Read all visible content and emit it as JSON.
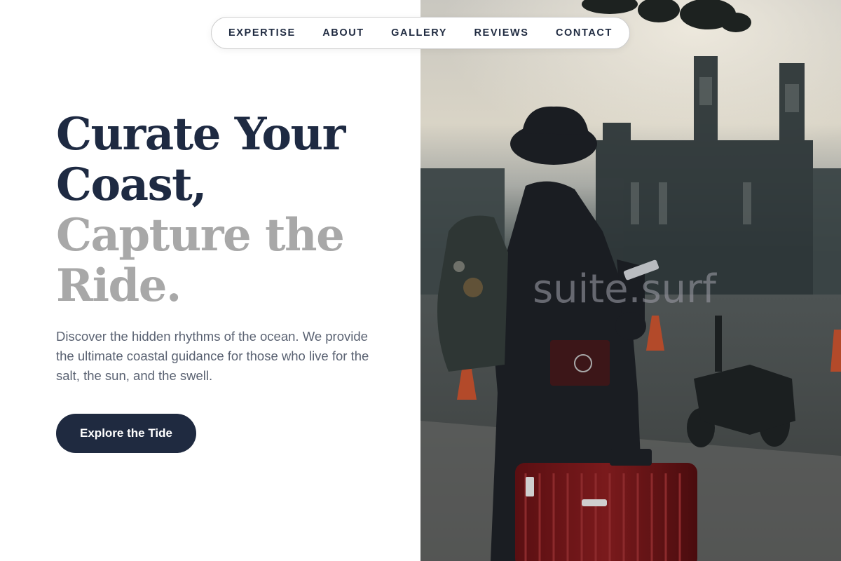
{
  "nav": {
    "items": [
      {
        "label": "EXPERTISE"
      },
      {
        "label": "ABOUT"
      },
      {
        "label": "GALLERY"
      },
      {
        "label": "REVIEWS"
      },
      {
        "label": "CONTACT"
      }
    ]
  },
  "hero": {
    "headline_dark": [
      "Curate Your",
      "Coast,"
    ],
    "headline_light": [
      "Capture the",
      "Ride."
    ],
    "description": "Discover the hidden rhythms of the ocean. We provide the ultimate coastal guidance for those who live for the salt, the sun, and the swell.",
    "cta_label": "Explore the Tide"
  },
  "image": {
    "watermark": "suite.surf",
    "icon": "traveler-photo"
  },
  "colors": {
    "primary": "#1f2a40",
    "headline_dark": "#1e2a42",
    "headline_light": "#a8a8a8",
    "body_text": "#5a6272"
  }
}
